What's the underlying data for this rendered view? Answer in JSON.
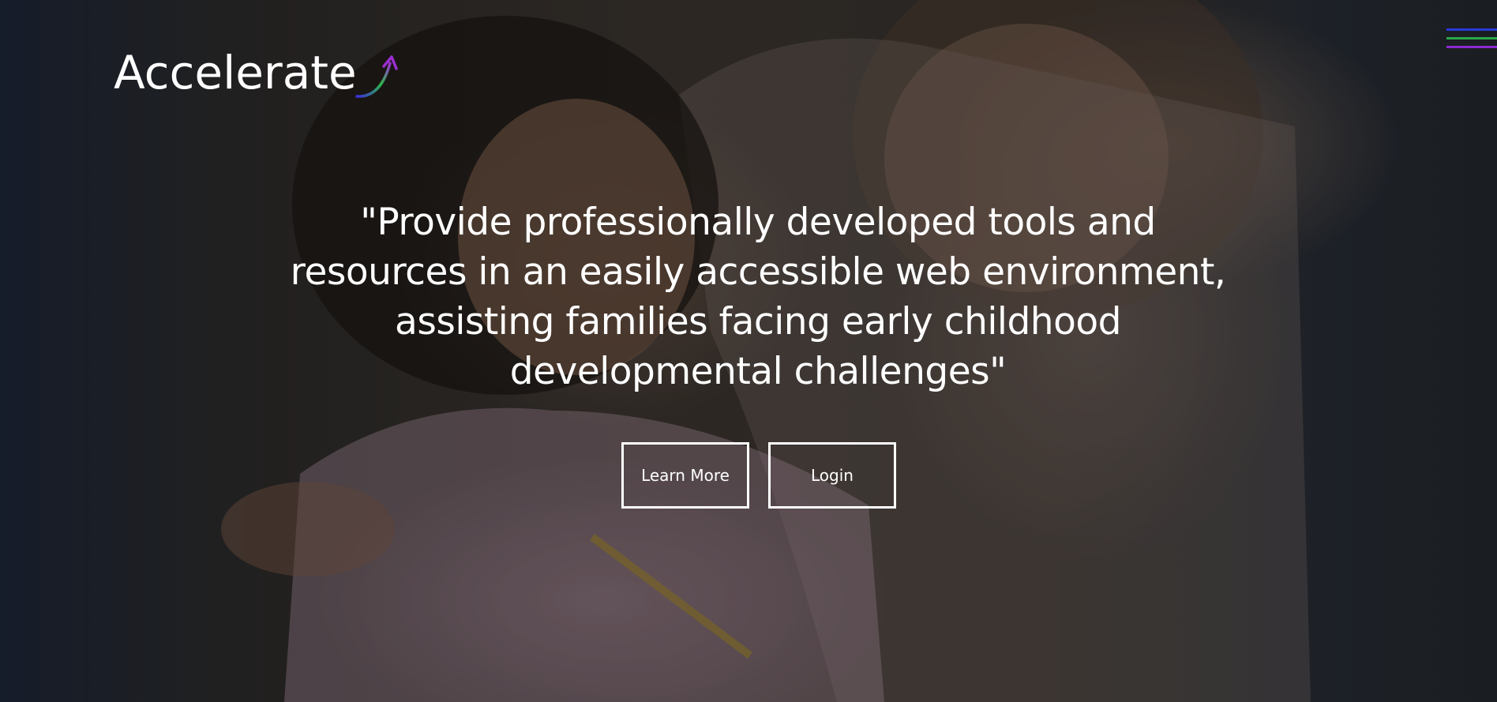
{
  "brand": {
    "logo_text": "Accelerate",
    "logo_icon": "rising-arrow-swoosh-icon",
    "swoosh_colors": [
      "#3b2fd6",
      "#2bb84a",
      "#9b2fd0"
    ]
  },
  "nav": {
    "menu_icon": "hamburger-menu-icon",
    "menu_bar_colors": [
      "#2a39d8",
      "#2aa84a",
      "#8c2bd0"
    ]
  },
  "hero": {
    "background": "photo of a smiling woman with her hand on a young girl's shoulder",
    "mission_text": "\"Provide professionally developed tools and resources in an easily accessible web environment, assisting families facing early childhood developmental challenges\""
  },
  "actions": {
    "learn_more_label": "Learn More",
    "login_label": "Login"
  }
}
